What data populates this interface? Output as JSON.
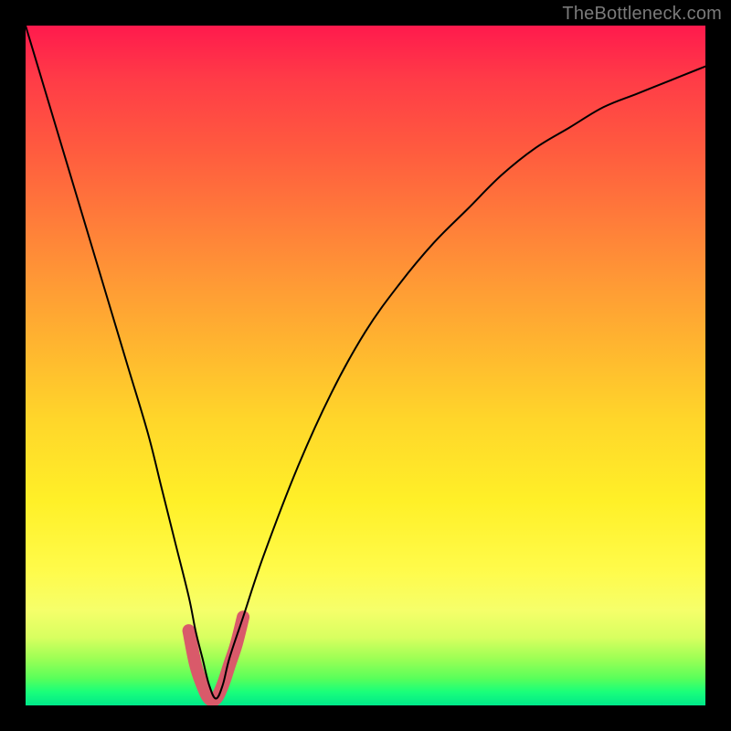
{
  "watermark": "TheBottleneck.com",
  "chart_data": {
    "type": "line",
    "title": "",
    "xlabel": "",
    "ylabel": "",
    "xlim": [
      0,
      100
    ],
    "ylim": [
      0,
      100
    ],
    "grid": false,
    "legend": false,
    "background": "gradient",
    "gradient_stops": [
      {
        "pos": 0,
        "color": "#ff1a4d"
      },
      {
        "pos": 50,
        "color": "#ffd62a"
      },
      {
        "pos": 85,
        "color": "#f6ff6a"
      },
      {
        "pos": 100,
        "color": "#00e88a"
      }
    ],
    "series": [
      {
        "name": "bottleneck-curve",
        "x": [
          0,
          3,
          6,
          9,
          12,
          15,
          18,
          20,
          22,
          24,
          25,
          26,
          27,
          28,
          29,
          30,
          32,
          35,
          40,
          45,
          50,
          55,
          60,
          65,
          70,
          75,
          80,
          85,
          90,
          95,
          100
        ],
        "y": [
          100,
          90,
          80,
          70,
          60,
          50,
          40,
          32,
          24,
          16,
          11,
          7,
          3,
          1,
          3,
          7,
          13,
          22,
          35,
          46,
          55,
          62,
          68,
          73,
          78,
          82,
          85,
          88,
          90,
          92,
          94
        ],
        "stroke": "#000000",
        "stroke_width": 2
      }
    ],
    "highlight_region": {
      "name": "optimal-range",
      "x": [
        24,
        25,
        26,
        27,
        28,
        29,
        30,
        31,
        32
      ],
      "y": [
        11,
        6,
        3,
        1,
        1,
        3,
        6,
        9,
        13
      ],
      "stroke": "#d95a6a",
      "stroke_width": 14
    }
  }
}
